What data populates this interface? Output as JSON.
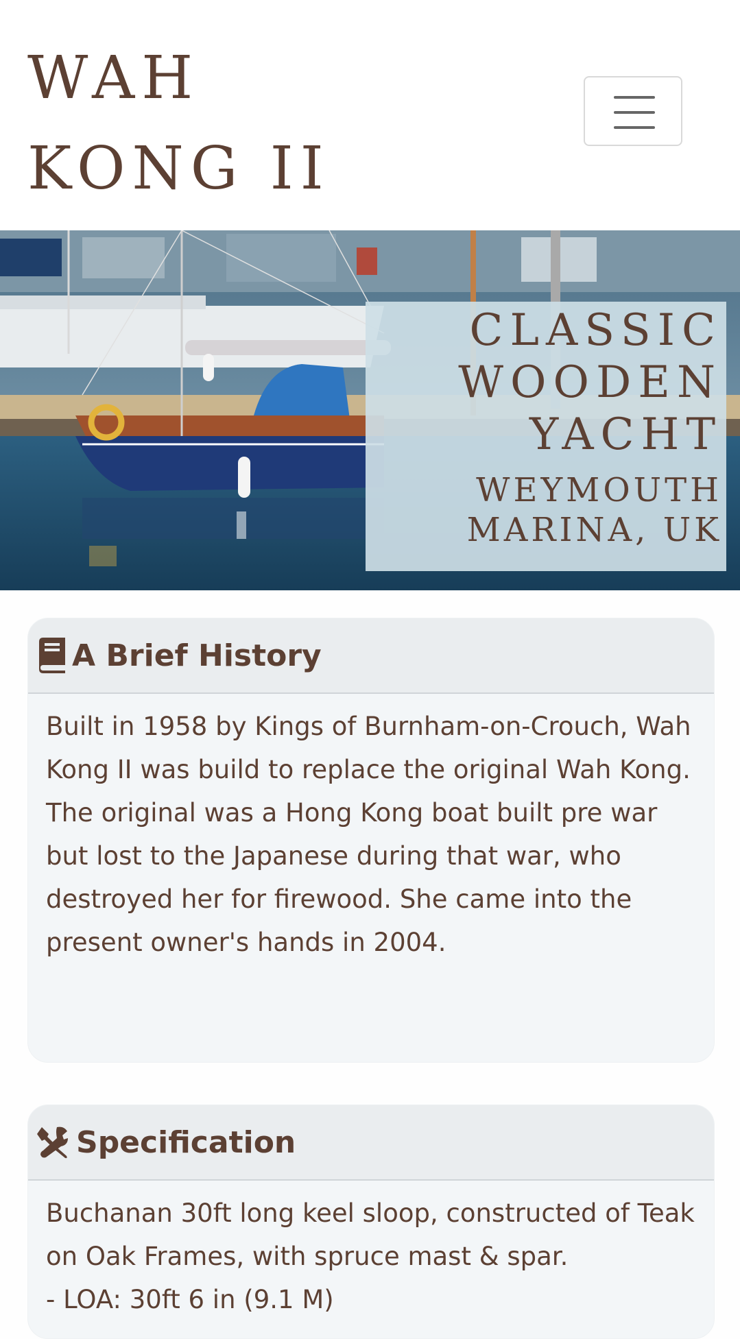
{
  "header": {
    "brand_line1": "WAH",
    "brand_line2": "KONG II",
    "menu_icon": "hamburger-menu-icon"
  },
  "hero": {
    "title_line1": "CLASSIC",
    "title_line2": "WOODEN",
    "title_line3": "YACHT",
    "subtitle_line1": "WEYMOUTH",
    "subtitle_line2": "MARINA, UK",
    "image_subject": "yacht-in-marina-photo"
  },
  "history": {
    "icon": "book-icon",
    "title": "A Brief History",
    "paragraph1": "Built in 1958 by Kings of Burnham-on-Crouch, Wah Kong II was build to replace the original Wah Kong.",
    "paragraph2": "The original was a Hong Kong boat built pre war but lost to the Japanese during that war, who destroyed her for firewood. She came into the present owner's hands in 2004."
  },
  "specification": {
    "icon": "tools-icon",
    "title": "Specification",
    "paragraph1": "Buchanan 30ft long keel sloop, constructed of Teak on Oak Frames, with spruce mast & spar.",
    "spec_item1": "- LOA: 30ft 6 in (9.1 M)"
  },
  "colors": {
    "brand_brown": "#5c4033",
    "card_background": "#f3f6f8",
    "card_header_background": "#eaedef",
    "hero_caption_background": "#cddee6"
  }
}
